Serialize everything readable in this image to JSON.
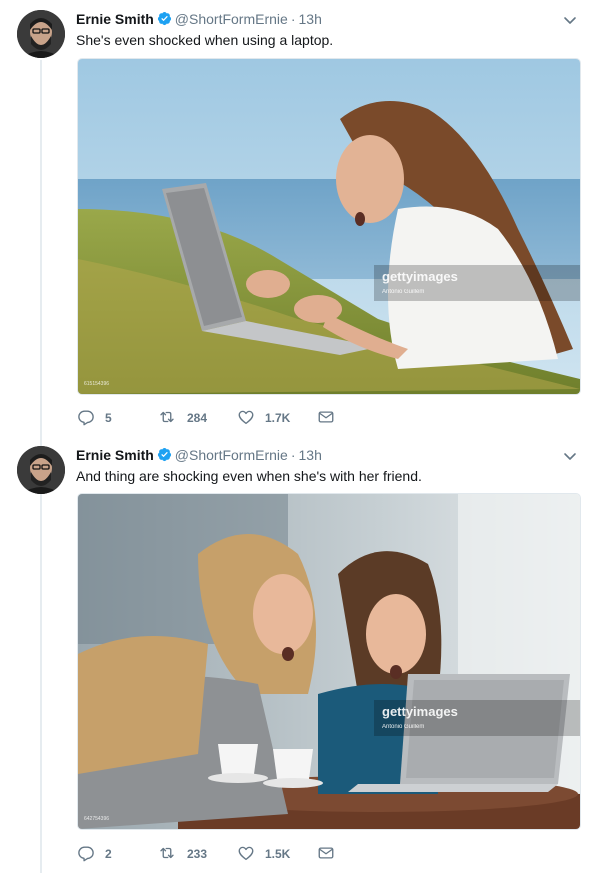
{
  "tweets": [
    {
      "author_name": "Ernie Smith",
      "handle": "@ShortFormErnie",
      "separator": "·",
      "time": "13h",
      "text": "She's even shocked when using a laptop.",
      "media": {
        "watermark_brand": "gettyimages",
        "watermark_credit": "Antonio Guillem",
        "stock_id": "615154396"
      },
      "stats": {
        "replies": "5",
        "retweets": "284",
        "likes": "1.7K"
      }
    },
    {
      "author_name": "Ernie Smith",
      "handle": "@ShortFormErnie",
      "separator": "·",
      "time": "13h",
      "text": "And thing are shocking even when she's with her friend.",
      "media": {
        "watermark_brand": "gettyimages",
        "watermark_credit": "Antonio Guillem",
        "stock_id": "642754396"
      },
      "stats": {
        "replies": "2",
        "retweets": "233",
        "likes": "1.5K"
      }
    }
  ],
  "colors": {
    "verified": "#1da1f2",
    "muted": "#657786",
    "thread_line": "#e6ecf0"
  },
  "icons": [
    "verified-badge-icon",
    "chevron-down-icon",
    "reply-icon",
    "retweet-icon",
    "like-icon",
    "direct-message-icon"
  ]
}
